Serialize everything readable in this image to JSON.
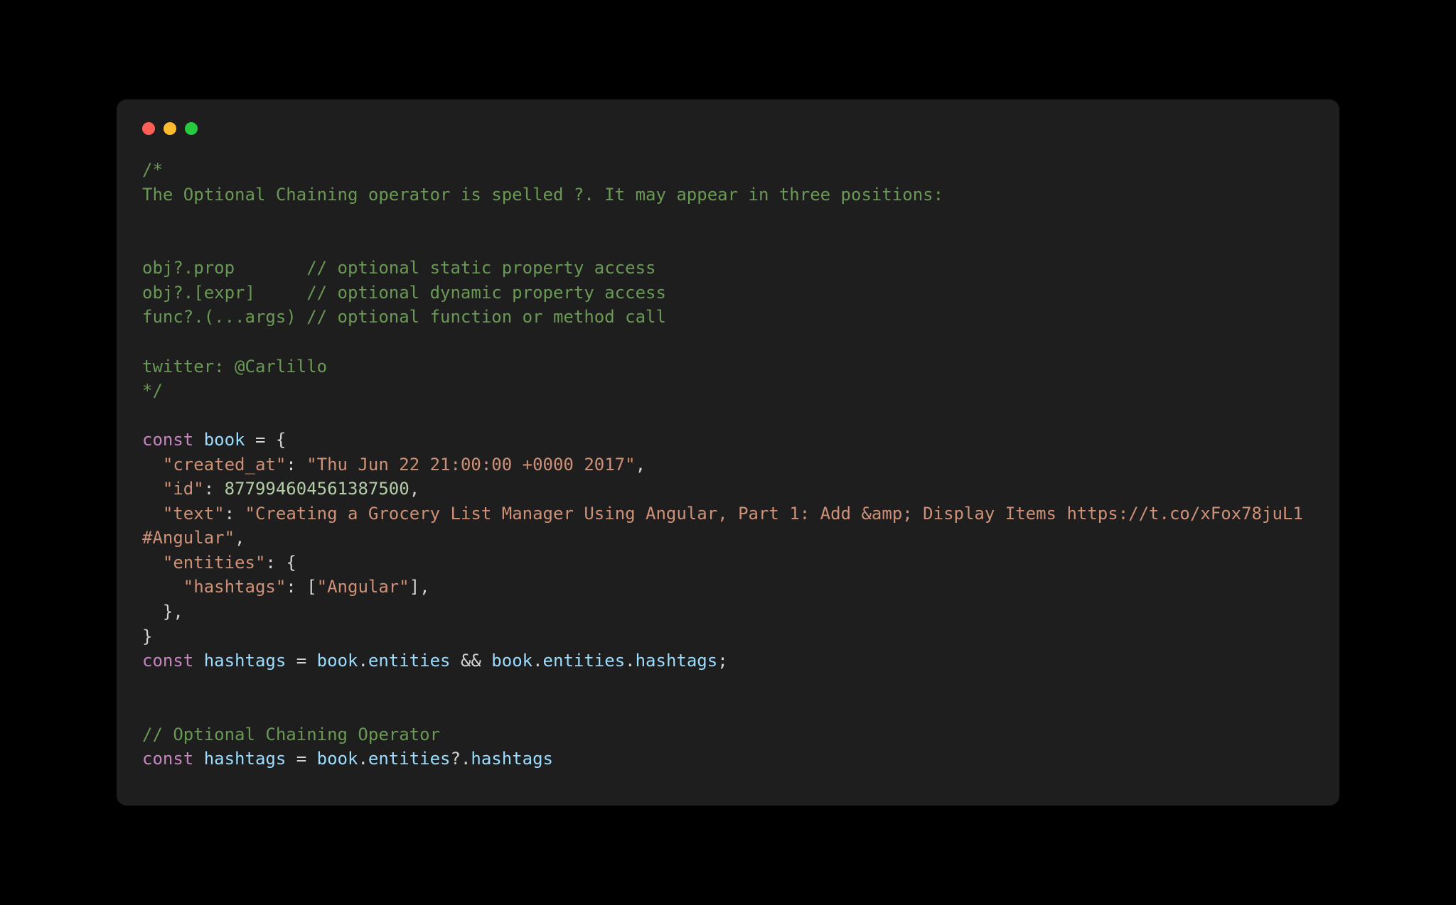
{
  "colors": {
    "bg": "#000000",
    "window": "#1e1e1e",
    "red": "#ff5f56",
    "yellow": "#ffbd2e",
    "green": "#27c93f",
    "comment": "#6a9955",
    "keyword": "#c586c0",
    "variable": "#9cdcfe",
    "string": "#ce9178",
    "number": "#b5cea8",
    "default": "#d4d4d4"
  },
  "code": {
    "comment_block": {
      "open": "/*",
      "l1": "The Optional Chaining operator is spelled ?. It may appear in three positions:",
      "l2": "obj?.prop       // optional static property access",
      "l3": "obj?.[expr]     // optional dynamic property access",
      "l4": "func?.(...args) // optional function or method call",
      "l5": "twitter: @Carlillo",
      "close": "*/"
    },
    "decl1": {
      "const": "const",
      "name": "book",
      "eq": " = {"
    },
    "obj": {
      "k_created": "\"created_at\"",
      "v_created": "\"Thu Jun 22 21:00:00 +0000 2017\"",
      "k_id": "\"id\"",
      "v_id": "877994604561387500",
      "k_text": "\"text\"",
      "v_text": "\"Creating a Grocery List Manager Using Angular, Part 1: Add &amp; Display Items https://t.co/xFox78juL1 #Angular\"",
      "k_entities": "\"entities\"",
      "k_hashtags": "\"hashtags\"",
      "v_hashtags": "\"Angular\""
    },
    "punc": {
      "colon": ": ",
      "comma": ",",
      "open_brace": "{",
      "close_brace": "}",
      "open_bracket": "[",
      "close_bracket": "]",
      "semicolon": ";",
      "indent1": "  ",
      "indent2": "    "
    },
    "decl2": {
      "const": "const",
      "name": "hashtags",
      "eq": " = ",
      "lhs_obj": "book",
      "dot": ".",
      "lhs_prop": "entities",
      "and": " && ",
      "rhs_obj": "book",
      "rhs_p1": "entities",
      "rhs_p2": "hashtags"
    },
    "comment_line": "// Optional Chaining Operator",
    "decl3": {
      "const": "const",
      "name": "hashtags",
      "eq": " = ",
      "obj": "book",
      "dot": ".",
      "p1": "entities",
      "opt": "?.",
      "p2": "hashtags"
    }
  }
}
